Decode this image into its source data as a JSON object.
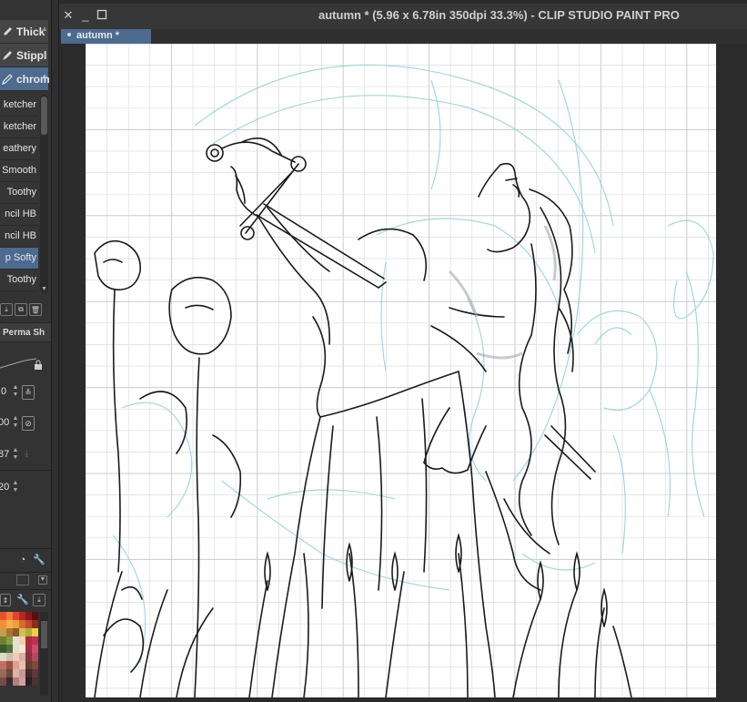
{
  "window": {
    "title": "autumn * (5.96 x 6.78in 350dpi 33.3%)  - CLIP STUDIO PAINT PRO",
    "close_icon": "close-icon",
    "minimize_icon": "minimize-icon",
    "maximize_icon": "maximize-icon"
  },
  "tabs": [
    {
      "label": "autumn *",
      "active": true
    }
  ],
  "sub_tools": [
    {
      "label": "Thick",
      "icon": "pen-icon",
      "active": false
    },
    {
      "label": "Stippl",
      "icon": "pen-icon",
      "active": false
    },
    {
      "label": "chrom",
      "icon": "pencil-icon",
      "active": true
    }
  ],
  "brushes": [
    {
      "label": "ketcher",
      "active": false
    },
    {
      "label": "ketcher",
      "active": false
    },
    {
      "label": "eathery",
      "active": false
    },
    {
      "label": "Smooth",
      "active": false
    },
    {
      "label": "Toothy",
      "active": false
    },
    {
      "label": "ncil HB",
      "active": false
    },
    {
      "label": "ncil HB",
      "active": false
    },
    {
      "label": "p Softy",
      "active": true
    },
    {
      "label": "Toothy",
      "active": false
    }
  ],
  "tool_property": {
    "title": "Perma Sh",
    "values": [
      ".0",
      "00",
      "87",
      "20"
    ]
  },
  "colors": {
    "accent": "#4d6a8f",
    "sketch_line": "#1a1a1a",
    "guide_line": "#8fd3d8",
    "grid": "#d9dde0"
  },
  "palette": [
    "#e8542a",
    "#f07f3a",
    "#e2452e",
    "#b42a1d",
    "#8a1a1a",
    "#5a0f12",
    "#f2903a",
    "#f6b04a",
    "#e8a23a",
    "#d86a2a",
    "#c24a2a",
    "#8a2e1c",
    "#c2a050",
    "#b07030",
    "#8a5a2a",
    "#d0c050",
    "#a8b038",
    "#f0d040",
    "#708030",
    "#8aa038",
    "#e0e0e0",
    "#f4d2a8",
    "#b02a3a",
    "#c03050",
    "#3a5a2a",
    "#507040",
    "#e8e0c0",
    "#f0e8d8",
    "#a0304a",
    "#d04a6a",
    "#e0d8c8",
    "#c8c0b0",
    "#f2c8b8",
    "#d8b0a0",
    "#8a3040",
    "#b04860",
    "#c07060",
    "#a05040",
    "#d8a090",
    "#e8c0b0",
    "#604030",
    "#804a3a",
    "#9a6a5a",
    "#6a4a40",
    "#e0b0a8",
    "#c89890",
    "#402a2a",
    "#5a3a3a",
    "#7a4a4a",
    "#3a2a2a",
    "#b08080",
    "#d0a0a0",
    "#2a2020",
    "#503030"
  ]
}
